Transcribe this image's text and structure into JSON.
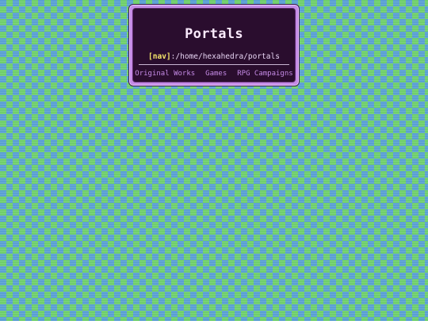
{
  "panel": {
    "title": "Portals",
    "nav_tag": "[nav]",
    "path": ":/home/hexahedra/portals",
    "links": [
      {
        "label": "Original Works"
      },
      {
        "label": "Games"
      },
      {
        "label": "RPG Campaigns"
      }
    ]
  },
  "colors": {
    "checker_green": "#6fcf6b",
    "checker_blue": "#5a9fd4",
    "panel_border": "#c58be6",
    "panel_bg": "#2a0d2e",
    "link": "#c58be6",
    "nav_tag": "#f7e86a"
  }
}
